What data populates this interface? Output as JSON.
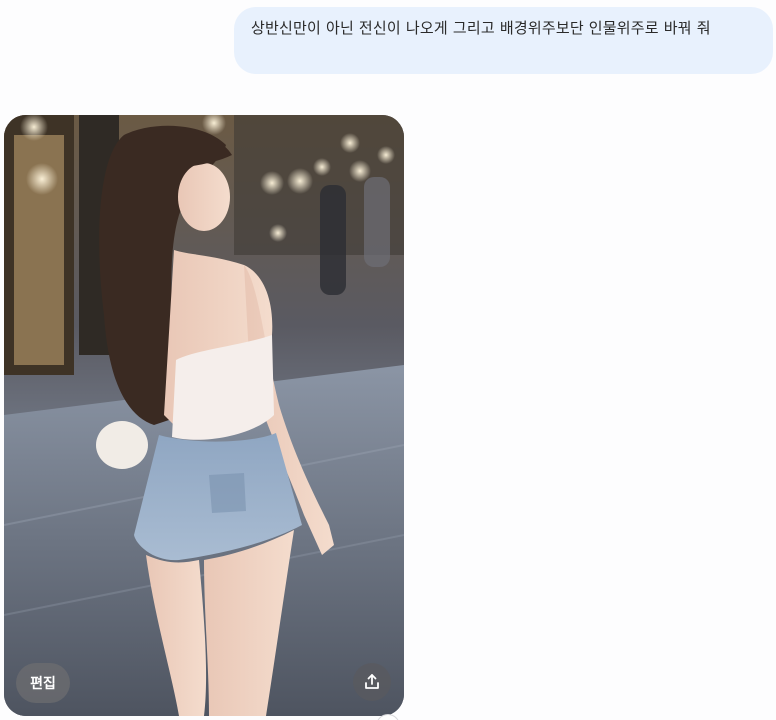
{
  "conversation": {
    "user_message": "상반신만이 아닌 전신이 나오게 그리고 배경위주보단 인물위주로 바꿔 줘",
    "generated_image": {
      "description_icon": "photo-woman-street-night",
      "edit_label": "편집",
      "share_icon": "share-upload-icon"
    }
  },
  "colors": {
    "bubble_bg": "#e8f1fd",
    "page_bg": "#fdfdfe",
    "text": "#2a2a2a"
  }
}
